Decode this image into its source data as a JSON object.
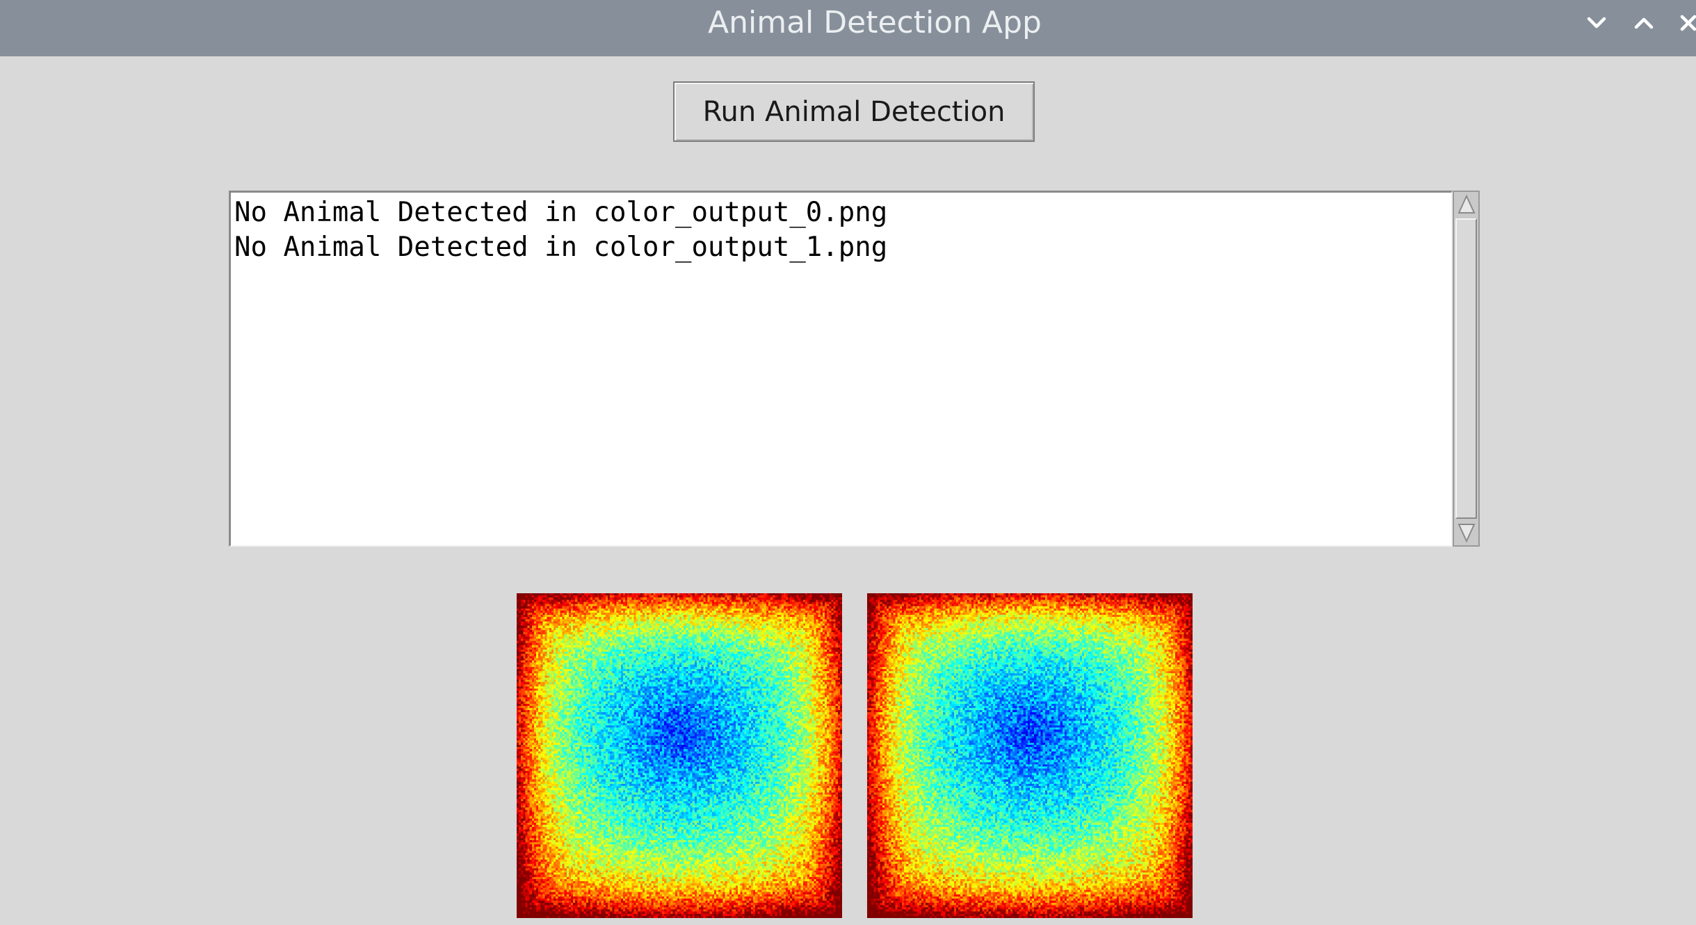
{
  "window": {
    "title": "Animal Detection App",
    "controls": {
      "minimize_icon": "chevron-down-icon",
      "maximize_icon": "chevron-up-icon",
      "close_icon": "close-icon"
    }
  },
  "toolbar": {
    "run_label": "Run Animal Detection"
  },
  "log": {
    "lines": [
      "No Animal Detected in color_output_0.png",
      "No Animal Detected in color_output_1.png"
    ]
  },
  "images": [
    {
      "name": "color_output_0.png",
      "colormap": "jet"
    },
    {
      "name": "color_output_1.png",
      "colormap": "jet"
    }
  ],
  "colors": {
    "titlebar": "#87909a",
    "title_text": "#eceff1",
    "background": "#d9d9d9",
    "log_background": "#ffffff"
  }
}
